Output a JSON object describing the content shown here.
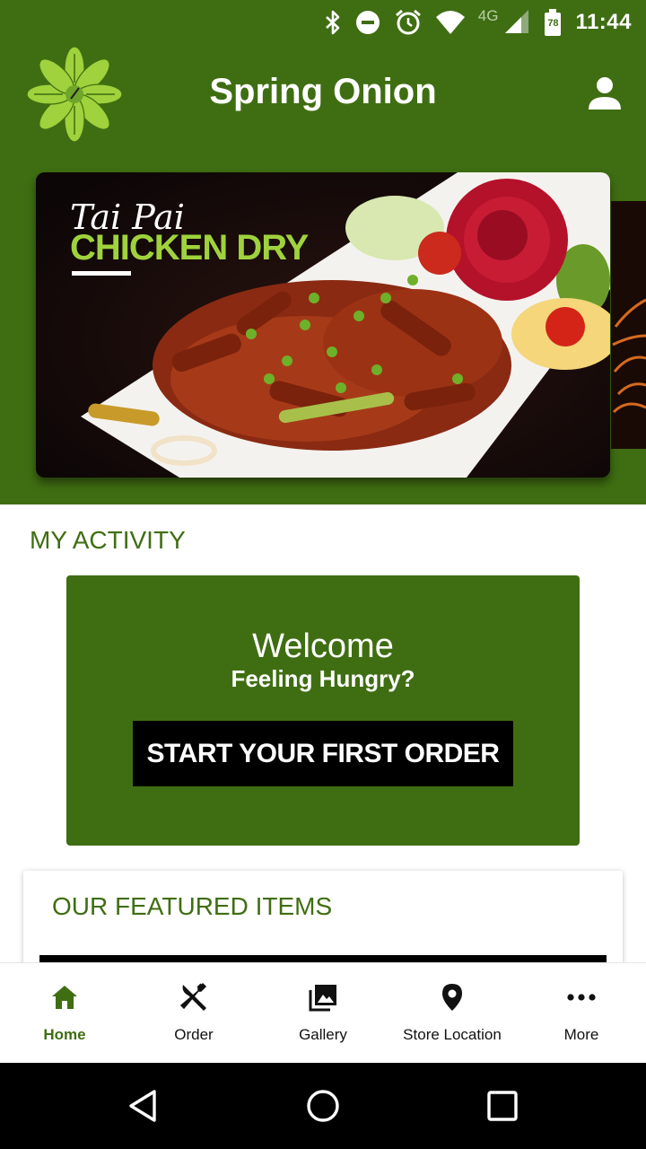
{
  "status_bar": {
    "time": "11:44",
    "network": "4G",
    "battery_level": "78",
    "icons": [
      "bluetooth-icon",
      "do-not-disturb-icon",
      "alarm-icon",
      "wifi-icon",
      "signal-icon",
      "battery-icon"
    ]
  },
  "app": {
    "title": "Spring Onion",
    "brand_color": "#3f6e12"
  },
  "banner": {
    "script_text": "Tai Pai",
    "title": "CHICKEN DRY"
  },
  "activity": {
    "heading": "MY ACTIVITY",
    "welcome_title": "Welcome",
    "welcome_subtitle": "Feeling Hungry?",
    "start_order_label": "START YOUR FIRST ORDER"
  },
  "featured": {
    "heading": "OUR FEATURED ITEMS"
  },
  "bottom_nav": {
    "items": [
      {
        "label": "Home",
        "icon": "home-icon",
        "active": true
      },
      {
        "label": "Order",
        "icon": "fork-knife-icon",
        "active": false
      },
      {
        "label": "Gallery",
        "icon": "gallery-icon",
        "active": false
      },
      {
        "label": "Store Location",
        "icon": "location-pin-icon",
        "active": false
      },
      {
        "label": "More",
        "icon": "more-dots-icon",
        "active": false
      }
    ]
  },
  "system_nav": {
    "buttons": [
      "back-icon",
      "home-circle-icon",
      "recents-icon"
    ]
  }
}
